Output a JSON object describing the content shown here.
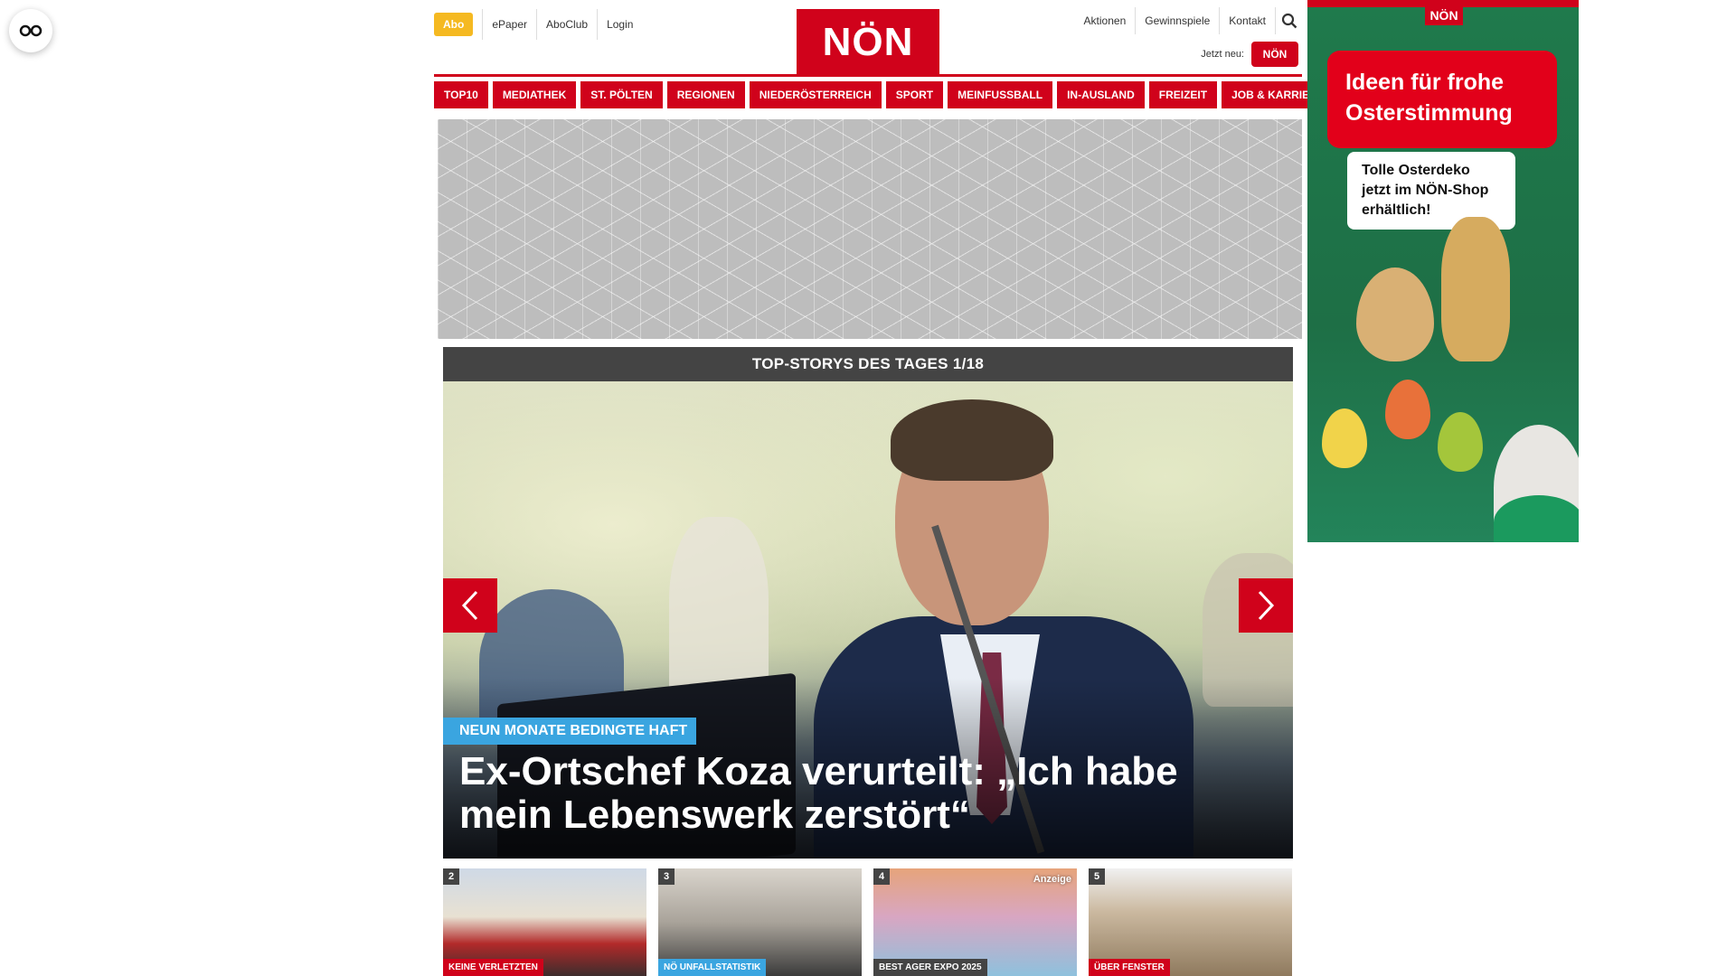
{
  "accessibility": {
    "icon": "glasses-icon"
  },
  "header": {
    "abo_label": "Abo",
    "top_links_left": [
      "ePaper",
      "AboClub",
      "Login"
    ],
    "logo_text": "NÖN",
    "top_links_right": [
      "Aktionen",
      "Gewinnspiele",
      "Kontakt"
    ],
    "search_icon": "search-icon",
    "jetzt_neu_label": "Jetzt neu:",
    "kids_logo_text": "NÖN"
  },
  "nav": {
    "items": [
      "TOP10",
      "MEDIATHEK",
      "ST. PÖLTEN",
      "REGIONEN",
      "NIEDERÖSTERREICH",
      "SPORT",
      "MEINFUSSBALL",
      "IN-AUSLAND",
      "FREIZEIT",
      "JOB & KARRIERE"
    ]
  },
  "topstory": {
    "header": "TOP-STORYS DES TAGES 1/18",
    "kicker": "NEUN MONATE BEDINGTE HAFT",
    "headline": "Ex-Ortschef Koza verurteilt: „Ich habe mein Lebenswerk zerstört“"
  },
  "thumbs": [
    {
      "num": "2",
      "tag": "KEINE VERLETZTEN",
      "tag_color": "#d0021b"
    },
    {
      "num": "3",
      "tag": "NÖ UNFALLSTATISTIK",
      "tag_color": "#3aa5e0"
    },
    {
      "num": "4",
      "tag": "BEST AGER EXPO 2025",
      "tag_color": "#444444",
      "anzeige": "Anzeige"
    },
    {
      "num": "5",
      "tag": "ÜBER FENSTER",
      "tag_color": "#d0021b"
    }
  ],
  "side_ad": {
    "logo_text": "NÖN",
    "headline": "Ideen für frohe Osterstimmung",
    "subline": "Tolle Osterdeko jetzt im NÖN-Shop erhältlich!"
  },
  "colors": {
    "brand_red": "#d0021b",
    "abo_yellow": "#f5b921",
    "kicker_blue": "#3aa5e0"
  }
}
